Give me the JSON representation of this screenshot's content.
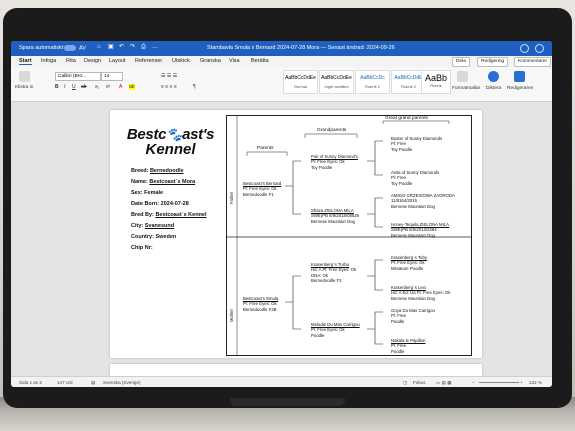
{
  "titlebar": {
    "autosave": "Spara automatiskt",
    "autosave_state": "AV",
    "doc_title": "Stambavla Smula x Bernard 2024-07-28 Mora — Senast ändrad: 2024-09-26"
  },
  "ribbon": {
    "tabs": [
      "Start",
      "Infoga",
      "Rita",
      "Design",
      "Layout",
      "Referenser",
      "Utskick",
      "Granska",
      "Visa",
      "Berätta"
    ],
    "paste_label": "Klistra in",
    "font_name": "Calibri (Brö...",
    "font_size": "14",
    "styles": [
      {
        "sample": "AaBbCcDdEe",
        "name": "Normal"
      },
      {
        "sample": "AaBbCcDdEe",
        "name": "Inget avstånd"
      },
      {
        "sample": "AaBbCcDc",
        "name": "Rubrik 1"
      },
      {
        "sample": "AaBbCcDdE",
        "name": "Rubrik 2"
      },
      {
        "sample": "AaBb",
        "name": "Rubrik"
      }
    ],
    "styles_pane": "Formatmallar",
    "dictate": "Diktera",
    "editor": "Redigeraren",
    "share": "Dela",
    "editing": "Redigering",
    "comments": "Kommentarer"
  },
  "kennel": {
    "logo_line1_a": "Bestc",
    "logo_line1_b": "ast's",
    "logo_line2": "Kennel",
    "fields": [
      {
        "label": "Breed:",
        "value": "Bernedoodle",
        "underline": true
      },
      {
        "label": "Name:",
        "value": "Bestcoast´s Mora",
        "underline": true
      },
      {
        "label": "Sex:",
        "value": "Female",
        "underline": false
      },
      {
        "label": "Date Born:",
        "value": "2024-07-28",
        "underline": false
      },
      {
        "label": "Bred By:",
        "value": "Bestcoast´s Kennel",
        "underline": true
      },
      {
        "label": "City:",
        "value": "Svanesund",
        "underline": true
      },
      {
        "label": "Country:",
        "value": "Sweden",
        "underline": false
      },
      {
        "label": "Chip Nr:",
        "value": "",
        "underline": false
      }
    ]
  },
  "pedigree": {
    "headers": {
      "parents": "Parents",
      "grandparents": "Grandparents",
      "great_grandparents": "Great grand parents"
    },
    "father_label": "Father",
    "mother_label": "Mother",
    "father": [
      "Bestcoast's Bernard",
      "Pl: Free Eyes: Ok",
      "Bernedoodle F1"
    ],
    "mother": [
      "Bestcoast's Smula",
      "Pl: Free Eyes: Ok",
      "Bernedoodle F2B"
    ],
    "gp_ff": [
      "Puk of Sunny Diamond's",
      "Pl: Free Eyes: Ok",
      "Toy Poodle"
    ],
    "gp_fm": [
      "Shaza ZIELONA MILA",
      "SWE(PB 8/9/2018/08526",
      "Bernese Mountain Dog"
    ],
    "gp_mf": [
      "Krasenberg´s Turbo",
      "Hd: A Pl: Free Eyes: Ok",
      "DNA: Ok",
      "Bernedoodle F1"
    ],
    "gp_mm": [
      "Melodie Du Mas Carrigou",
      "Pl: Free Eyes: Ok",
      "Poodle"
    ],
    "ggp": [
      [
        "Buster of Sunny Diamonds",
        "Pl: Free",
        "Toy Poodle"
      ],
      [
        "Avita of Sunny Diamonds",
        "Pl: Free",
        "Toy Poodle"
      ],
      [
        "AMIGO GRZESIOWA ZAGRODA",
        "11/8164/2015",
        "Bernese Mountain Dog"
      ],
      [
        "Honey-Tequila ZIELONA MILA",
        "SWE(PB 8/9/2013/2284",
        "Bernese Mountain Dog"
      ],
      [
        "Krasenberg´s Toby",
        "Pl: Free Eyes: Ok",
        "Miniature Poodle"
      ],
      [
        "Krasenberg´s Lexi",
        "Hd: A Ed: Ua Pl: Free Eyes: Ok",
        "Bernese Mountain Dog"
      ],
      [
        "Goya Du Mas Carrigou",
        "Pl: Free",
        "Poodle"
      ],
      [
        "Nakala le Papillon",
        "Pl: Free",
        "Poodle"
      ]
    ]
  },
  "statusbar": {
    "page": "Sida 1 av 2",
    "words": "147 ord",
    "language": "Svenska (Sverige)",
    "focus": "Fokus",
    "zoom": "132 %"
  }
}
